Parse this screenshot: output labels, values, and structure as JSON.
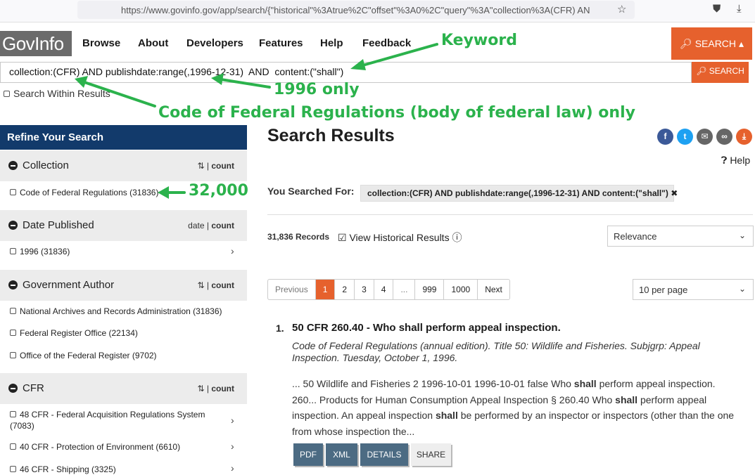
{
  "browser": {
    "url": "https://www.govinfo.gov/app/search/{\"historical\"%3Atrue%2C\"offset\"%3A0%2C\"query\"%3A\"collection%3A(CFR) AN"
  },
  "site": {
    "logo_text": "GovInfo",
    "nav": [
      "Browse",
      "About",
      "Developers",
      "Features",
      "Help",
      "Feedback"
    ],
    "top_search_label": "SEARCH"
  },
  "query_bar": {
    "value": "collection:(CFR) AND publishdate:range(,1996-12-31)  AND  content:(\"shall\")",
    "search_label": "SEARCH",
    "search_within_label": "Search Within Results"
  },
  "annotations": {
    "keyword": "Keyword",
    "year": "1996 only",
    "collection": "Code of Federal Regulations (body of federal law) only",
    "count": "32,000",
    "color": "#2bb24c"
  },
  "sidebar": {
    "header": "Refine Your Search",
    "facets": [
      {
        "title": "Collection",
        "sort_a": "",
        "sort_b": "count",
        "items": [
          "Code of Federal Regulations (31836)"
        ]
      },
      {
        "title": "Date Published",
        "sort_a": "date",
        "sort_b": "count",
        "items": [
          "1996 (31836)"
        ]
      },
      {
        "title": "Government Author",
        "sort_a": "",
        "sort_b": "count",
        "items": [
          "National Archives and Records Administration (31836)",
          "Federal Register Office (22134)",
          "Office of the Federal Register (9702)"
        ]
      },
      {
        "title": "CFR",
        "sort_a": "",
        "sort_b": "count",
        "items": [
          "48 CFR - Federal Acquisition Regulations System (7083)",
          "40 CFR - Protection of Environment (6610)",
          "46 CFR - Shipping (3325)"
        ]
      }
    ]
  },
  "main": {
    "title": "Search Results",
    "help_label": "Help",
    "you_searched_label": "You Searched For:",
    "query_chip": "collection:(CFR) AND publishdate:range(,1996-12-31) AND content:(\"shall\")",
    "record_count": "31,836 Records",
    "view_historical": "View Historical Results",
    "sort_select": "Relevance",
    "per_page_select": "10 per page",
    "pagination": [
      "Previous",
      "1",
      "2",
      "3",
      "4",
      "...",
      "999",
      "1000",
      "Next"
    ],
    "current_page": "1"
  },
  "result": {
    "number": "1.",
    "title": "50 CFR 260.40 - Who shall perform appeal inspection.",
    "meta": "Code of Federal Regulations (annual edition). Title 50: Wildlife and Fisheries. Subjgrp: Appeal Inspection. Tuesday, October 1, 1996.",
    "snippet": [
      {
        "t": "... 50 Wildlife and Fisheries 2 1996-10-01 1996-10-01 false Who ",
        "b": false
      },
      {
        "t": "shall",
        "b": true
      },
      {
        "t": " perform appeal inspection. 260... Products for Human Consumption Appeal Inspection § 260.40 Who ",
        "b": false
      },
      {
        "t": "shall",
        "b": true
      },
      {
        "t": " perform appeal inspection. An appeal inspection ",
        "b": false
      },
      {
        "t": "shall",
        "b": true
      },
      {
        "t": " be performed by an inspector or inspectors (other than the one from whose inspection the...",
        "b": false
      }
    ],
    "buttons": [
      "PDF",
      "XML",
      "DETAILS",
      "SHARE"
    ]
  },
  "colors": {
    "accent": "#e6612d",
    "navy": "#123a6b",
    "button": "#4c6b83",
    "facebook": "#3b5998",
    "twitter": "#1da1f2",
    "email": "#666666",
    "link": "#666666",
    "download": "#e6612d"
  }
}
